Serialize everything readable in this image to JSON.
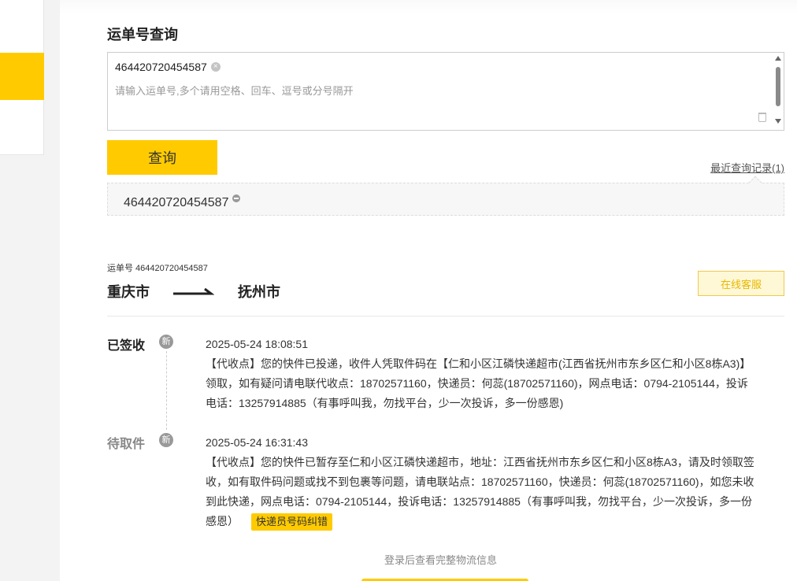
{
  "query": {
    "title": "运单号查询",
    "entered_number": "464420720454587",
    "placeholder": "请输入运单号,多个请用空格、回车、逗号或分号隔开",
    "submit_label": "查询",
    "recent_link": "最近查询记录(1)",
    "history": [
      "464420720454587"
    ]
  },
  "result": {
    "waybill_label": "运单号 464420720454587",
    "origin": "重庆市",
    "destination": "抚州市",
    "service_label": "在线客服",
    "events": [
      {
        "status": "已签收",
        "badge": "新",
        "time": "2025-05-24 18:08:51",
        "description": "【代收点】您的快件已投递，收件人凭取件码在【仁和小区江磷快递超市(江西省抚州市东乡区仁和小区8栋A3)】领取，如有疑问请电联代收点：18702571160，快递员：何蕊(18702571160)，网点电话：0794-2105144，投诉电话：13257914885（有事呼叫我，勿找平台，少一次投诉，多一份感恩)"
      },
      {
        "status": "待取件",
        "badge": "新",
        "time": "2025-05-24 16:31:43",
        "description": "【代收点】您的快件已暂存至仁和小区江磷快递超市，地址：江西省抚州市东乡区仁和小区8栋A3，请及时领取签收，如有取件码问题或找不到包裹等问题，请电联站点：18702571160，快递员：何蕊(18702571160)，如您未收到此快递，网点电话：0794-2105144，投诉电话：13257914885（有事呼叫我，勿找平台，少一次投诉，多一份感恩）",
        "action_label": "快递员号码纠错"
      }
    ],
    "login_hint": "登录后查看完整物流信息"
  },
  "colors": {
    "accent": "#ffcb00",
    "service_text": "#e8b800",
    "badge": "#999999"
  }
}
